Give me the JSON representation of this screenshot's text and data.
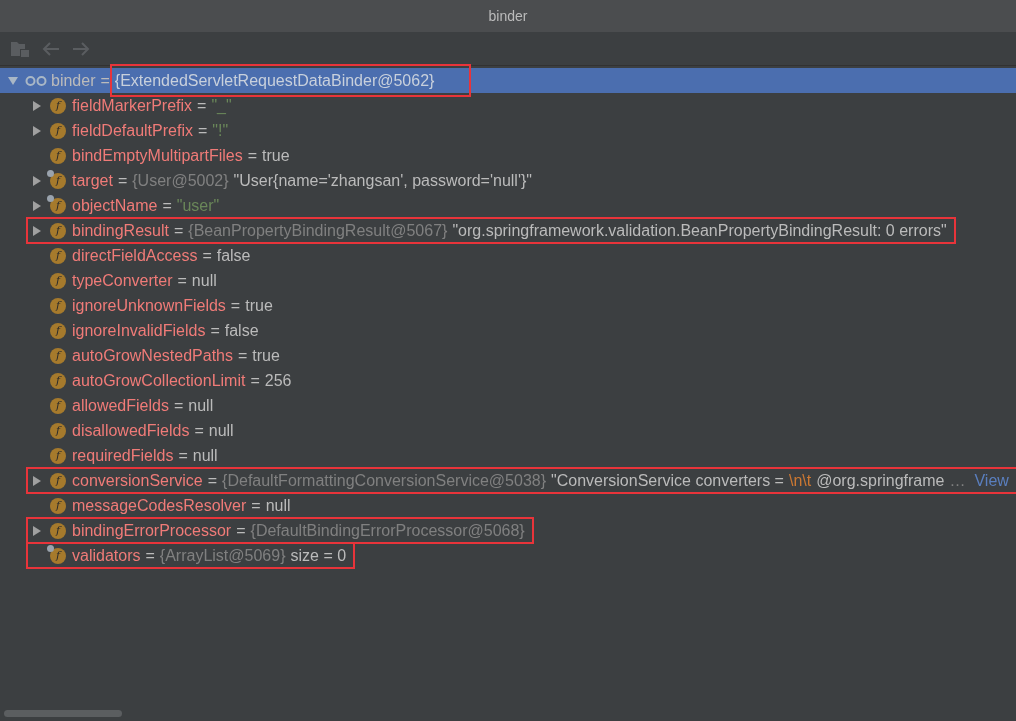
{
  "window": {
    "title": "binder"
  },
  "toolbar": [
    {
      "kind": "folder",
      "disabled": true
    },
    {
      "kind": "back",
      "disabled": true
    },
    {
      "kind": "forward",
      "disabled": true
    }
  ],
  "tree": {
    "name": "binder",
    "sep": "=",
    "selected": true,
    "expanded": true,
    "annotated": true,
    "value": [
      {
        "kind": "type",
        "text": "{ExtendedServletRequestDataBinder@5062}"
      }
    ],
    "children": [
      {
        "name": "fieldMarkerPrefix",
        "sep": "=",
        "badge": "f",
        "expandable": true,
        "marked": false,
        "annotated": false,
        "value": [
          {
            "kind": "string",
            "text": "\"_\""
          }
        ]
      },
      {
        "name": "fieldDefaultPrefix",
        "sep": "=",
        "badge": "f",
        "expandable": true,
        "marked": false,
        "annotated": false,
        "value": [
          {
            "kind": "string",
            "text": "\"!\""
          }
        ]
      },
      {
        "name": "bindEmptyMultipartFiles",
        "sep": "=",
        "badge": "f",
        "expandable": false,
        "marked": false,
        "annotated": false,
        "value": [
          {
            "kind": "plain",
            "text": "true"
          }
        ]
      },
      {
        "name": "target",
        "sep": "=",
        "badge": "f",
        "expandable": true,
        "marked": true,
        "annotated": false,
        "value": [
          {
            "kind": "type",
            "text": "{User@5002}"
          },
          {
            "kind": "text",
            "text": "\"User{name='zhangsan', password='null'}\""
          }
        ]
      },
      {
        "name": "objectName",
        "sep": "=",
        "badge": "f",
        "expandable": true,
        "marked": true,
        "annotated": false,
        "value": [
          {
            "kind": "string",
            "text": "\"user\""
          }
        ]
      },
      {
        "name": "bindingResult",
        "sep": "=",
        "badge": "f",
        "expandable": true,
        "marked": false,
        "annotated": true,
        "value": [
          {
            "kind": "type",
            "text": "{BeanPropertyBindingResult@5067}"
          },
          {
            "kind": "text",
            "text": "\"org.springframework.validation.BeanPropertyBindingResult: 0 errors\""
          }
        ]
      },
      {
        "name": "directFieldAccess",
        "sep": "=",
        "badge": "f",
        "expandable": false,
        "marked": false,
        "annotated": false,
        "value": [
          {
            "kind": "plain",
            "text": "false"
          }
        ]
      },
      {
        "name": "typeConverter",
        "sep": "=",
        "badge": "f",
        "expandable": false,
        "marked": false,
        "annotated": false,
        "value": [
          {
            "kind": "plain",
            "text": "null"
          }
        ]
      },
      {
        "name": "ignoreUnknownFields",
        "sep": "=",
        "badge": "f",
        "expandable": false,
        "marked": false,
        "annotated": false,
        "value": [
          {
            "kind": "plain",
            "text": "true"
          }
        ]
      },
      {
        "name": "ignoreInvalidFields",
        "sep": "=",
        "badge": "f",
        "expandable": false,
        "marked": false,
        "annotated": false,
        "value": [
          {
            "kind": "plain",
            "text": "false"
          }
        ]
      },
      {
        "name": "autoGrowNestedPaths",
        "sep": "=",
        "badge": "f",
        "expandable": false,
        "marked": false,
        "annotated": false,
        "value": [
          {
            "kind": "plain",
            "text": "true"
          }
        ]
      },
      {
        "name": "autoGrowCollectionLimit",
        "sep": "=",
        "badge": "f",
        "expandable": false,
        "marked": false,
        "annotated": false,
        "value": [
          {
            "kind": "plain",
            "text": "256"
          }
        ]
      },
      {
        "name": "allowedFields",
        "sep": "=",
        "badge": "f",
        "expandable": false,
        "marked": false,
        "annotated": false,
        "value": [
          {
            "kind": "plain",
            "text": "null"
          }
        ]
      },
      {
        "name": "disallowedFields",
        "sep": "=",
        "badge": "f",
        "expandable": false,
        "marked": false,
        "annotated": false,
        "value": [
          {
            "kind": "plain",
            "text": "null"
          }
        ]
      },
      {
        "name": "requiredFields",
        "sep": "=",
        "badge": "f",
        "expandable": false,
        "marked": false,
        "annotated": false,
        "value": [
          {
            "kind": "plain",
            "text": "null"
          }
        ]
      },
      {
        "name": "conversionService",
        "sep": "=",
        "badge": "f",
        "expandable": true,
        "marked": false,
        "annotated": true,
        "value": [
          {
            "kind": "type",
            "text": "{DefaultFormattingConversionService@5038}"
          },
          {
            "kind": "text",
            "text": "\"ConversionService converters ="
          },
          {
            "kind": "escape",
            "text": "\\n\\t"
          },
          {
            "kind": "text",
            "text": "@org.springframe"
          },
          {
            "kind": "type",
            "text": "…"
          },
          {
            "kind": "link",
            "text": "View"
          }
        ]
      },
      {
        "name": "messageCodesResolver",
        "sep": "=",
        "badge": "f",
        "expandable": false,
        "marked": false,
        "annotated": false,
        "value": [
          {
            "kind": "plain",
            "text": "null"
          }
        ]
      },
      {
        "name": "bindingErrorProcessor",
        "sep": "=",
        "badge": "f",
        "expandable": true,
        "marked": false,
        "annotated": true,
        "value": [
          {
            "kind": "type",
            "text": "{DefaultBindingErrorProcessor@5068}"
          }
        ]
      },
      {
        "name": "validators",
        "sep": "=",
        "badge": "f",
        "expandable": false,
        "marked": true,
        "annotated": true,
        "value": [
          {
            "kind": "type",
            "text": "{ArrayList@5069}"
          },
          {
            "kind": "plain",
            "text": "size = 0"
          }
        ]
      }
    ]
  }
}
